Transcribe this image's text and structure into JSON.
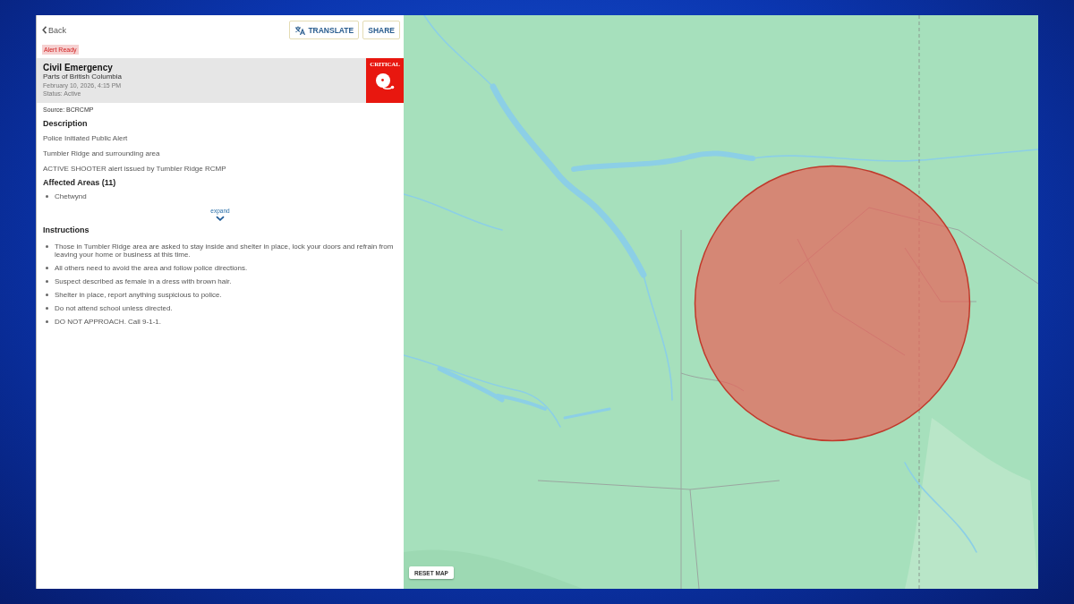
{
  "header": {
    "back": "Back",
    "buttons": [
      {
        "label": "TRANSLATE",
        "kind": "translate"
      },
      {
        "label": "SHARE",
        "kind": "plain"
      }
    ]
  },
  "tag": "Alert Ready",
  "alert": {
    "title": "Civil Emergency",
    "area": "Parts of British Columbia",
    "issued": "February 10, 2026, 4:15 PM",
    "status": "Status: Active",
    "severity": "CRITICAL"
  },
  "source": "Source: BCRCMP",
  "description": {
    "heading": "Description",
    "lines": [
      "Police Initiated Public Alert",
      "Tumbler Ridge and surrounding area",
      "ACTIVE SHOOTER alert issued by Tumbler Ridge RCMP"
    ]
  },
  "affected_areas": {
    "heading": "Affected Areas (11)",
    "items": [
      "Chetwynd"
    ],
    "expand": "expand"
  },
  "instructions": {
    "heading": "Instructions",
    "items": [
      "Those in Tumbler Ridge area are asked to stay inside and shelter in place, lock your doors and refrain from leaving your home or business at this time.",
      "All others need to avoid the area and follow police directions.",
      "Suspect described as female in a dress with brown hair.",
      "Shelter in place, report anything suspicious to police.",
      "Do not attend school unless directed.",
      "DO NOT APPROACH. Call 9-1-1."
    ]
  },
  "map": {
    "reset": "RESET MAP"
  }
}
